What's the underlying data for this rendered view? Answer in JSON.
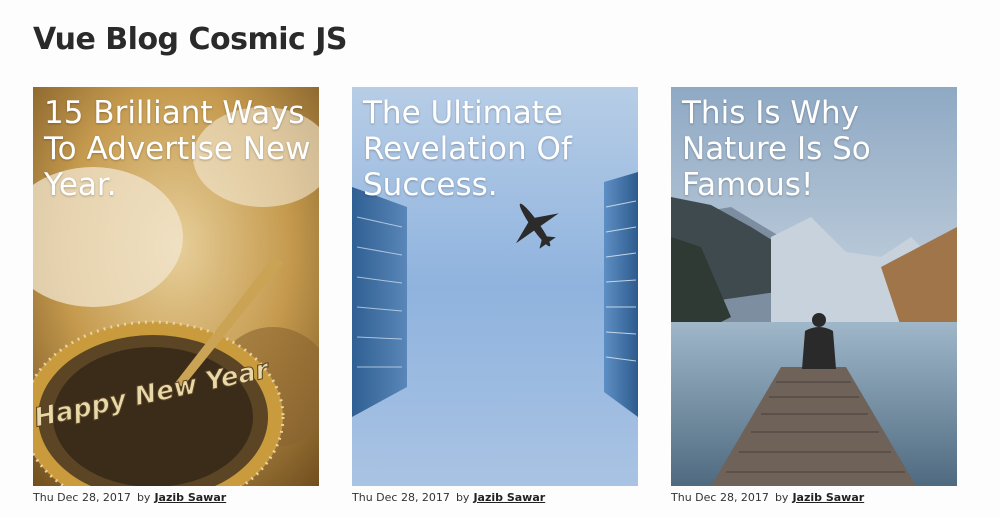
{
  "site": {
    "title": "Vue Blog Cosmic JS"
  },
  "posts": [
    {
      "title": "15 Brilliant Ways To Advertise New Year.",
      "date": "Thu Dec 28, 2017",
      "by": "by",
      "author": "Jazib Sawar",
      "image_text": "Happy New Year"
    },
    {
      "title": "The Ultimate Revelation Of Success.",
      "date": "Thu Dec 28, 2017",
      "by": "by",
      "author": "Jazib Sawar"
    },
    {
      "title": "This Is Why Nature Is So Famous!",
      "date": "Thu Dec 28, 2017",
      "by": "by",
      "author": "Jazib Sawar"
    }
  ],
  "colors": {
    "title_text": "#2a2a2a",
    "overlay_text": "#ffffff",
    "sky_blue": "#8fb3de",
    "gold": "#b98a3a"
  }
}
